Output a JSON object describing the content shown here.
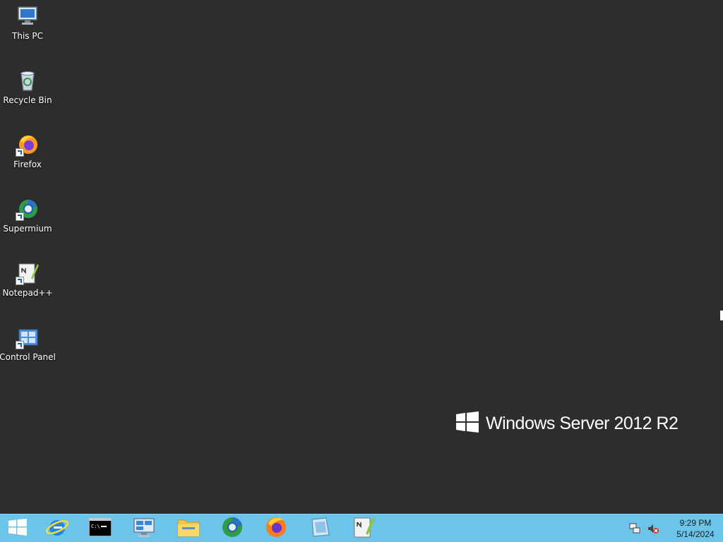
{
  "desktop": {
    "background_color": "#2d2d2d",
    "icons": [
      {
        "label": "This PC",
        "icon": "computer-icon"
      },
      {
        "label": "Recycle Bin",
        "icon": "recycle-bin-icon"
      },
      {
        "label": "Firefox",
        "icon": "firefox-icon"
      },
      {
        "label": "Supermium",
        "icon": "supermium-icon"
      },
      {
        "label": "Notepad++",
        "icon": "notepad-plus-plus-icon"
      },
      {
        "label": "Control Panel",
        "icon": "control-panel-icon"
      }
    ],
    "watermark": {
      "text": "Windows Server 2012 R2",
      "icon": "windows-logo-icon"
    }
  },
  "taskbar": {
    "background_color": "#6cc4e9",
    "pinned": [
      {
        "icon": "start-button-icon"
      },
      {
        "icon": "internet-explorer-icon"
      },
      {
        "icon": "command-prompt-icon"
      },
      {
        "icon": "server-manager-icon"
      },
      {
        "icon": "file-explorer-icon"
      },
      {
        "icon": "supermium-icon"
      },
      {
        "icon": "firefox-icon"
      },
      {
        "icon": "app-icon"
      },
      {
        "icon": "notepad-plus-plus-icon"
      }
    ],
    "tray": {
      "icons": [
        "network-icon",
        "volume-muted-icon"
      ],
      "time": "9:29 PM",
      "date": "5/14/2024"
    }
  }
}
